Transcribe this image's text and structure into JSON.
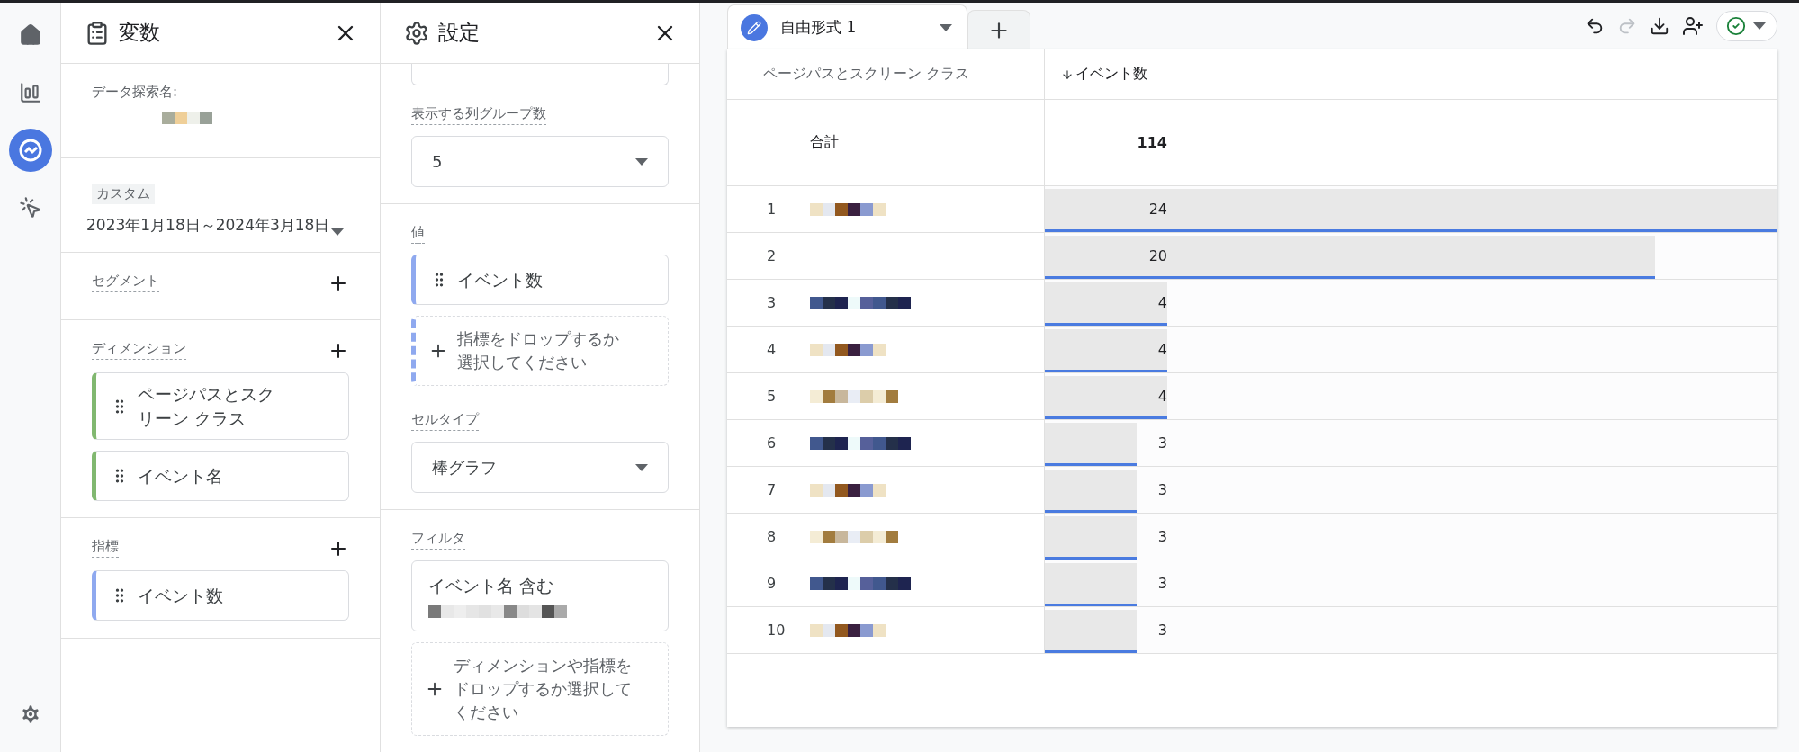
{
  "nav": {
    "items": [
      {
        "kind": "home",
        "selected": false
      },
      {
        "kind": "reports",
        "selected": false
      },
      {
        "kind": "explore",
        "selected": true
      },
      {
        "kind": "advertising",
        "selected": false
      }
    ],
    "footer": {
      "kind": "settings",
      "selected": false
    }
  },
  "variables_panel": {
    "title": "変数",
    "exploration_name_label": "データ探索名:",
    "date_range": {
      "badge": "カスタム",
      "value": "2023年1月18日～2024年3月18日"
    },
    "segments": {
      "label": "セグメント"
    },
    "dimensions": {
      "label": "ディメンション",
      "items": [
        "ページパスとスクリーン クラス",
        "イベント名"
      ]
    },
    "metrics": {
      "label": "指標",
      "items": [
        "イベント数"
      ]
    }
  },
  "settings_panel": {
    "title": "設定",
    "column_groups": {
      "label": "表示する列グループ数",
      "value": "5"
    },
    "values": {
      "label": "値",
      "items": [
        "イベント数"
      ],
      "drop_hint": "指標をドロップするか選択してください"
    },
    "cell_type": {
      "label": "セルタイプ",
      "value": "棒グラフ"
    },
    "filters": {
      "label": "フィルタ",
      "items": [
        "イベント名 含む"
      ],
      "drop_hint": "ディメンションや指標をドロップするか選択してください"
    }
  },
  "tabs": [
    {
      "label": "自由形式 1",
      "selected": true
    }
  ],
  "table": {
    "columns": [
      "ページパスとスクリーン クラス",
      "イベント数"
    ],
    "total": {
      "label": "合計",
      "value": "114"
    },
    "rows": [
      {
        "index": "1",
        "value": "24",
        "level": 1
      },
      {
        "index": "2",
        "value": "20",
        "level": 0.833
      },
      {
        "index": "3",
        "value": "4",
        "level": 0.167
      },
      {
        "index": "4",
        "value": "4",
        "level": 0.167
      },
      {
        "index": "5",
        "value": "4",
        "level": 0.167
      },
      {
        "index": "6",
        "value": "3",
        "level": 0.125
      },
      {
        "index": "7",
        "value": "3",
        "level": 0.125
      },
      {
        "index": "8",
        "value": "3",
        "level": 0.125
      },
      {
        "index": "9",
        "value": "3",
        "level": 0.125
      },
      {
        "index": "10",
        "value": "3",
        "level": 0.125
      }
    ]
  }
}
